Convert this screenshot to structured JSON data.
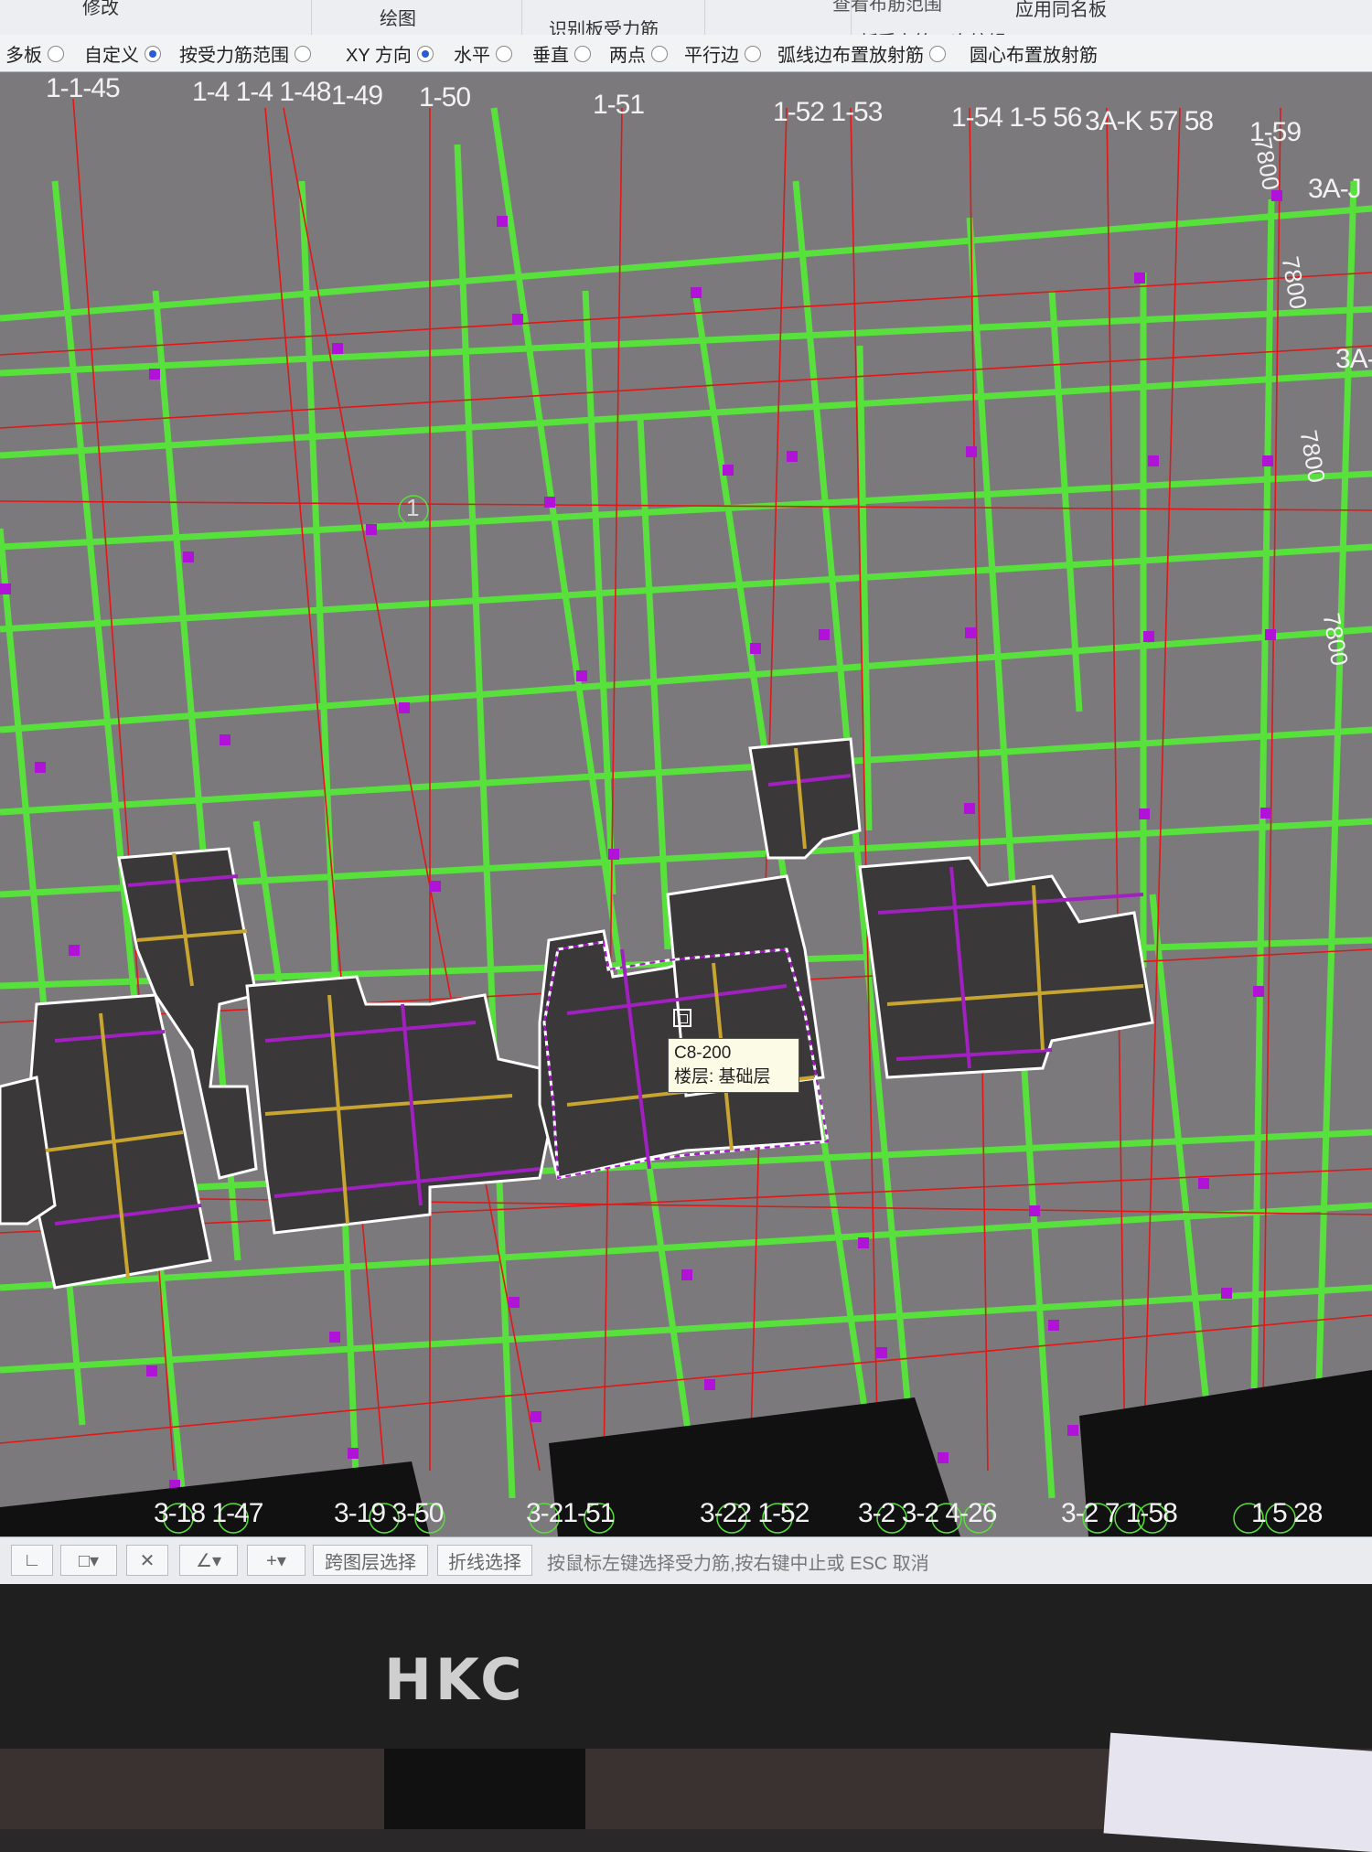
{
  "ribbon": {
    "modify": "修改",
    "draw": "绘图",
    "identify_slab_rebar": "识别板受力筋",
    "apply_same_name": "应用同名板",
    "rebar_edit": "板受力筋二次编辑",
    "view_range": "查看布筋范围"
  },
  "options": [
    {
      "label": "多板",
      "selected": false
    },
    {
      "label": "自定义",
      "selected": true
    },
    {
      "label": "按受力筋范围",
      "selected": false
    },
    {
      "label": "XY 方向",
      "selected": true
    },
    {
      "label": "水平",
      "selected": false
    },
    {
      "label": "垂直",
      "selected": false
    },
    {
      "label": "两点",
      "selected": false
    },
    {
      "label": "平行边",
      "selected": false
    },
    {
      "label": "弧线边布置放射筋",
      "selected": false
    },
    {
      "label": "圆心布置放射筋",
      "selected": false
    }
  ],
  "axes_top": [
    "1-1-45",
    "1-4 1-4 1-48",
    "1-49",
    "1-50",
    "1-51",
    "1-52 1-53",
    "1-54 1-5 56",
    "3A-K 57 58",
    "1-59"
  ],
  "axes_bottom": [
    "3-18 1-47",
    "3-19 3-50",
    "3-21-51",
    "3-22 1-52",
    "3-2 3-2 4-26",
    "3-2 7 1-58",
    "1 5 28"
  ],
  "axes_side": [
    "3A-J",
    "3A-"
  ],
  "dimensions": [
    "7800",
    "7800",
    "7800",
    "7800"
  ],
  "marker": "1",
  "tooltip": {
    "line1": "C8-200",
    "line2": "楼层: 基础层"
  },
  "status": {
    "cross_layer": "跨图层选择",
    "polyline": "折线选择",
    "hint": "按鼠标左键选择受力筋,按右键中止或 ESC 取消"
  },
  "brand": "HKC",
  "colors": {
    "beam": "#58e03c",
    "axis": "#e01818",
    "node": "#b012d8",
    "slab_fill": "#3a3838",
    "rebar_main": "#a020c0",
    "rebar_dist": "#c8a430",
    "outline": "#ffffff"
  }
}
